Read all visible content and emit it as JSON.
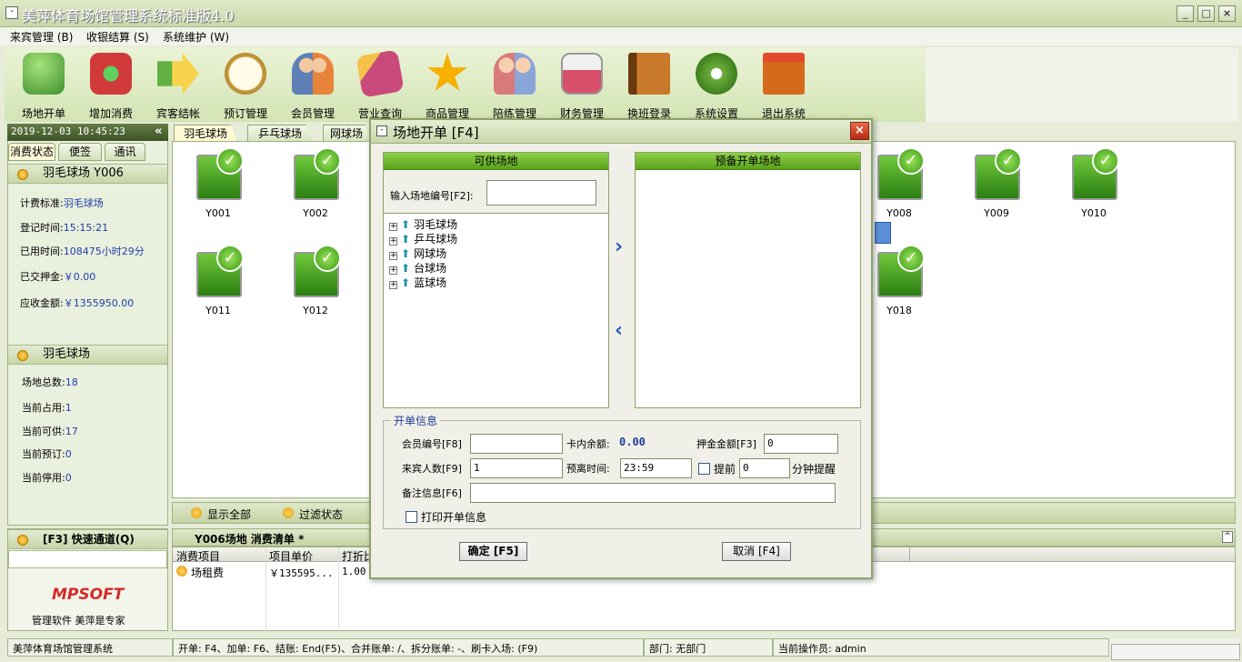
{
  "window": {
    "title": "美萍体育场馆管理系统标准版4.0",
    "minimize": "_",
    "restore": "□",
    "close": "×",
    "sys_icon": "-"
  },
  "menu": [
    {
      "label": "来宾管理 (B)"
    },
    {
      "label": "收银结算 (S)"
    },
    {
      "label": "系统维护 (W)"
    }
  ],
  "toolbar": [
    {
      "label": "场地开单",
      "icon": "person-computer-icon",
      "color": "#3c8f2d"
    },
    {
      "label": "增加消费",
      "icon": "plus-cart-icon",
      "color": "#d13a3a"
    },
    {
      "label": "宾客结帐",
      "icon": "dollar-arrow-icon",
      "color": "#f0c230"
    },
    {
      "label": "预订管理",
      "icon": "clock-icon",
      "color": "#c59a3a"
    },
    {
      "label": "会员管理",
      "icon": "members-icon",
      "color": "#5d7fb6"
    },
    {
      "label": "营业查询",
      "icon": "search-book-icon",
      "color": "#c94a7a"
    },
    {
      "label": "商品管理",
      "icon": "star-icon",
      "color": "#f5b000"
    },
    {
      "label": "陪练管理",
      "icon": "coach-icon",
      "color": "#d87a7a"
    },
    {
      "label": "财务管理",
      "icon": "calculator-icon",
      "color": "#d8506a"
    },
    {
      "label": "换班登录",
      "icon": "exit-door-icon",
      "color": "#9a5a1a"
    },
    {
      "label": "系统设置",
      "icon": "gears-icon",
      "color": "#6cae3a"
    },
    {
      "label": "退出系统",
      "icon": "exit-icon",
      "color": "#d56a1c"
    }
  ],
  "left": {
    "datetime": "2019-12-03 10:45:23",
    "collapse": "«",
    "tabs": [
      "消费状态",
      "便签",
      "通讯"
    ],
    "court_panel": {
      "title": "羽毛球场 Y006",
      "rows": [
        {
          "k": "计费标准:",
          "v": "羽毛球场"
        },
        {
          "k": "登记时间:",
          "v": "15:15:21"
        },
        {
          "k": "已用时间:",
          "v": "108475小时29分"
        },
        {
          "k": "已交押金:",
          "v": "￥0.00"
        },
        {
          "k": "应收金额:",
          "v": "￥1355950.00"
        }
      ]
    },
    "type_panel": {
      "title": "羽毛球场",
      "rows": [
        {
          "k": "场地总数:",
          "v": "18"
        },
        {
          "k": "当前占用:",
          "v": "1"
        },
        {
          "k": "当前可供:",
          "v": "17"
        },
        {
          "k": "当前预订:",
          "v": "0"
        },
        {
          "k": "当前停用:",
          "v": "0"
        }
      ]
    },
    "quick": {
      "title": "[F3] 快速通道(Q)",
      "logo": "MPSOFT",
      "slogan": "管理软件  美萍是专家"
    }
  },
  "court_tabs": [
    "羽毛球场",
    "乒乓球场",
    "网球场"
  ],
  "courts": [
    "Y001",
    "Y002",
    "Y008",
    "Y009",
    "Y010",
    "Y011",
    "Y012",
    "Y018"
  ],
  "courts_bottom": {
    "show_all": "显示全部",
    "filter": "过滤状态"
  },
  "list": {
    "title": "Y006场地  消费清单  *",
    "columns": [
      "消费项目",
      "项目单价",
      "打折比"
    ],
    "rows": [
      {
        "item": "场租费",
        "price": "￥135595...",
        "discount": "1.00"
      }
    ]
  },
  "status": {
    "app": "美萍体育场馆管理系统",
    "shortcuts": "开单: F4、加单: F6、结账: End(F5)、合并账单: /、拆分账单: -、刷卡入场: (F9)",
    "dept": "部门: 无部门",
    "operator": "当前操作员: admin"
  },
  "dialog": {
    "title": "场地开单  [F4]",
    "available_title": "可供场地",
    "reserve_title": "预备开单场地",
    "input_label": "输入场地编号[F2]:",
    "tree": [
      "羽毛球场",
      "乒乓球场",
      "网球场",
      "台球场",
      "蓝球场"
    ],
    "arrow_right": "›",
    "arrow_left": "‹",
    "info_title": "开单信息",
    "member_label": "会员编号[F8]",
    "balance_label": "卡内余额:",
    "balance_value": "0.00",
    "deposit_label": "押金金额[F3]",
    "deposit_value": "0",
    "guests_label": "来宾人数[F9]",
    "guests_value": "1",
    "leave_label": "预离时间:",
    "leave_value": "23:59",
    "advance_label": "提前",
    "advance_value": "0",
    "remind_label": "分钟提醒",
    "note_label": "备注信息[F6]",
    "print_label": "打印开单信息",
    "ok": "确定 [F5]",
    "cancel": "取消 [F4]"
  }
}
